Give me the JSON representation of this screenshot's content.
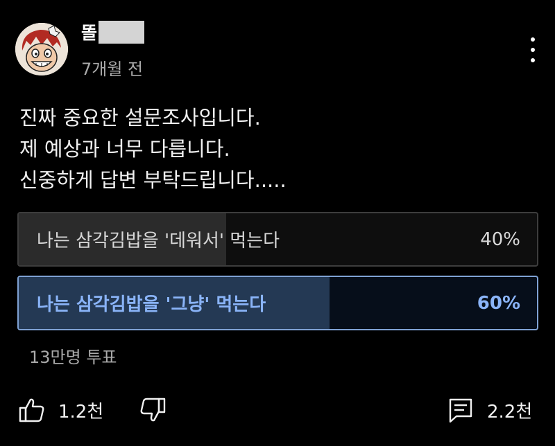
{
  "post": {
    "author": "똘",
    "time": "7개월 전",
    "text_lines": [
      "진짜 중요한 설문조사입니다.",
      "제 예상과 너무 다릅니다.",
      "신중하게 답변 부탁드립니다....."
    ]
  },
  "poll": {
    "options": [
      {
        "label": "나는 삼각김밥을 '데워서' 먹는다",
        "percent_text": "40%",
        "percent": 40,
        "selected": false
      },
      {
        "label": "나는 삼각김밥을 '그냥' 먹는다",
        "percent_text": "60%",
        "percent": 60,
        "selected": true
      }
    ],
    "votes": "13만명 투표"
  },
  "actions": {
    "like_count": "1.2천",
    "comment_count": "2.2천"
  },
  "icons": {
    "menu": "more-vert-icon",
    "like": "thumbs-up-icon",
    "dislike": "thumbs-down-icon",
    "comment": "comment-icon"
  },
  "colors": {
    "background": "#000000",
    "selected_text": "#8ab4f8",
    "selected_border": "#7fa2d4",
    "selected_fill": "#243954",
    "unselected_fill": "#2b2b2b"
  }
}
